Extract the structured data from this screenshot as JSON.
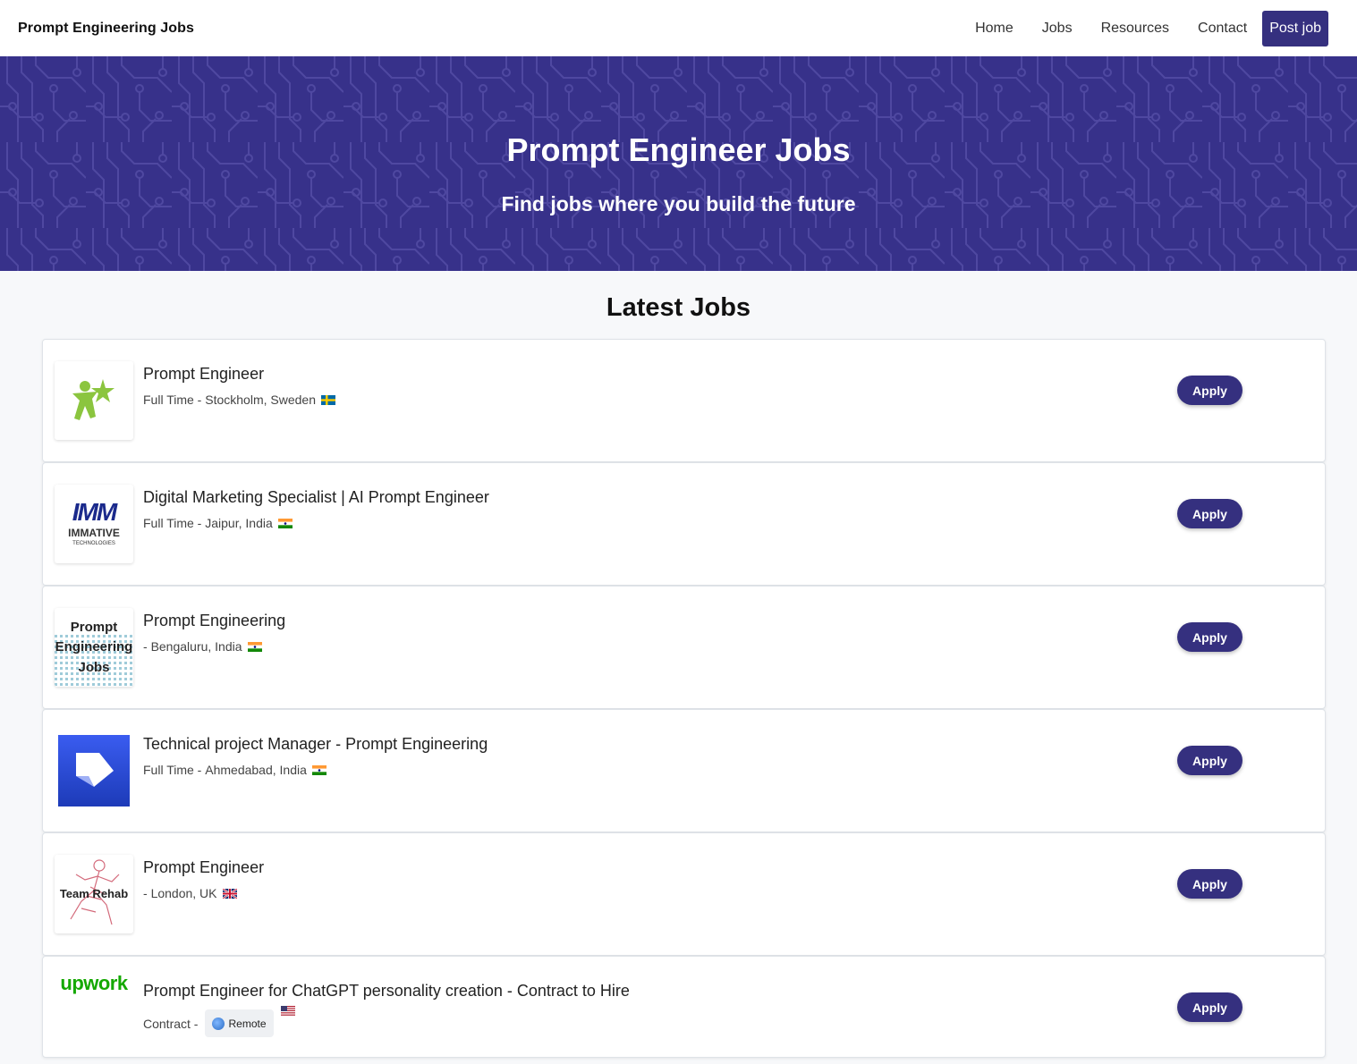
{
  "nav": {
    "brand": "Prompt Engineering Jobs",
    "links": [
      "Home",
      "Jobs",
      "Resources",
      "Contact"
    ],
    "post_job": "Post job"
  },
  "hero": {
    "title": "Prompt Engineer Jobs",
    "subtitle": "Find jobs where you build the future"
  },
  "section_title": "Latest Jobs",
  "apply_label": "Apply",
  "jobs": [
    {
      "title": "Prompt Engineer",
      "type": "Full Time",
      "location": "Stockholm, Sweden",
      "flag": "se"
    },
    {
      "title": "Digital Marketing Specialist | AI Prompt Engineer",
      "type": "Full Time",
      "location": "Jaipur, India",
      "flag": "in",
      "logo_text": "IMMATIVE",
      "logo_sub": "TECHNOLOGIES"
    },
    {
      "title": "Prompt Engineering",
      "type": "",
      "location": "Bengaluru, India",
      "flag": "in",
      "logo_lines": [
        "Prompt",
        "Engineering",
        "Jobs"
      ]
    },
    {
      "title": "Technical project Manager - Prompt Engineering",
      "type": "Full Time",
      "location": "Ahmedabad, India",
      "flag": "in"
    },
    {
      "title": "Prompt Engineer",
      "type": "",
      "location": "London, UK",
      "flag": "gb",
      "logo_text": "Team Rehab"
    },
    {
      "title": "Prompt Engineer for ChatGPT personality creation - Contract to Hire",
      "type": "Contract",
      "location": "Remote",
      "flag": "us",
      "logo_text": "upwork"
    }
  ],
  "colors": {
    "accent": "#35307f",
    "hero_bg": "#37318a"
  }
}
